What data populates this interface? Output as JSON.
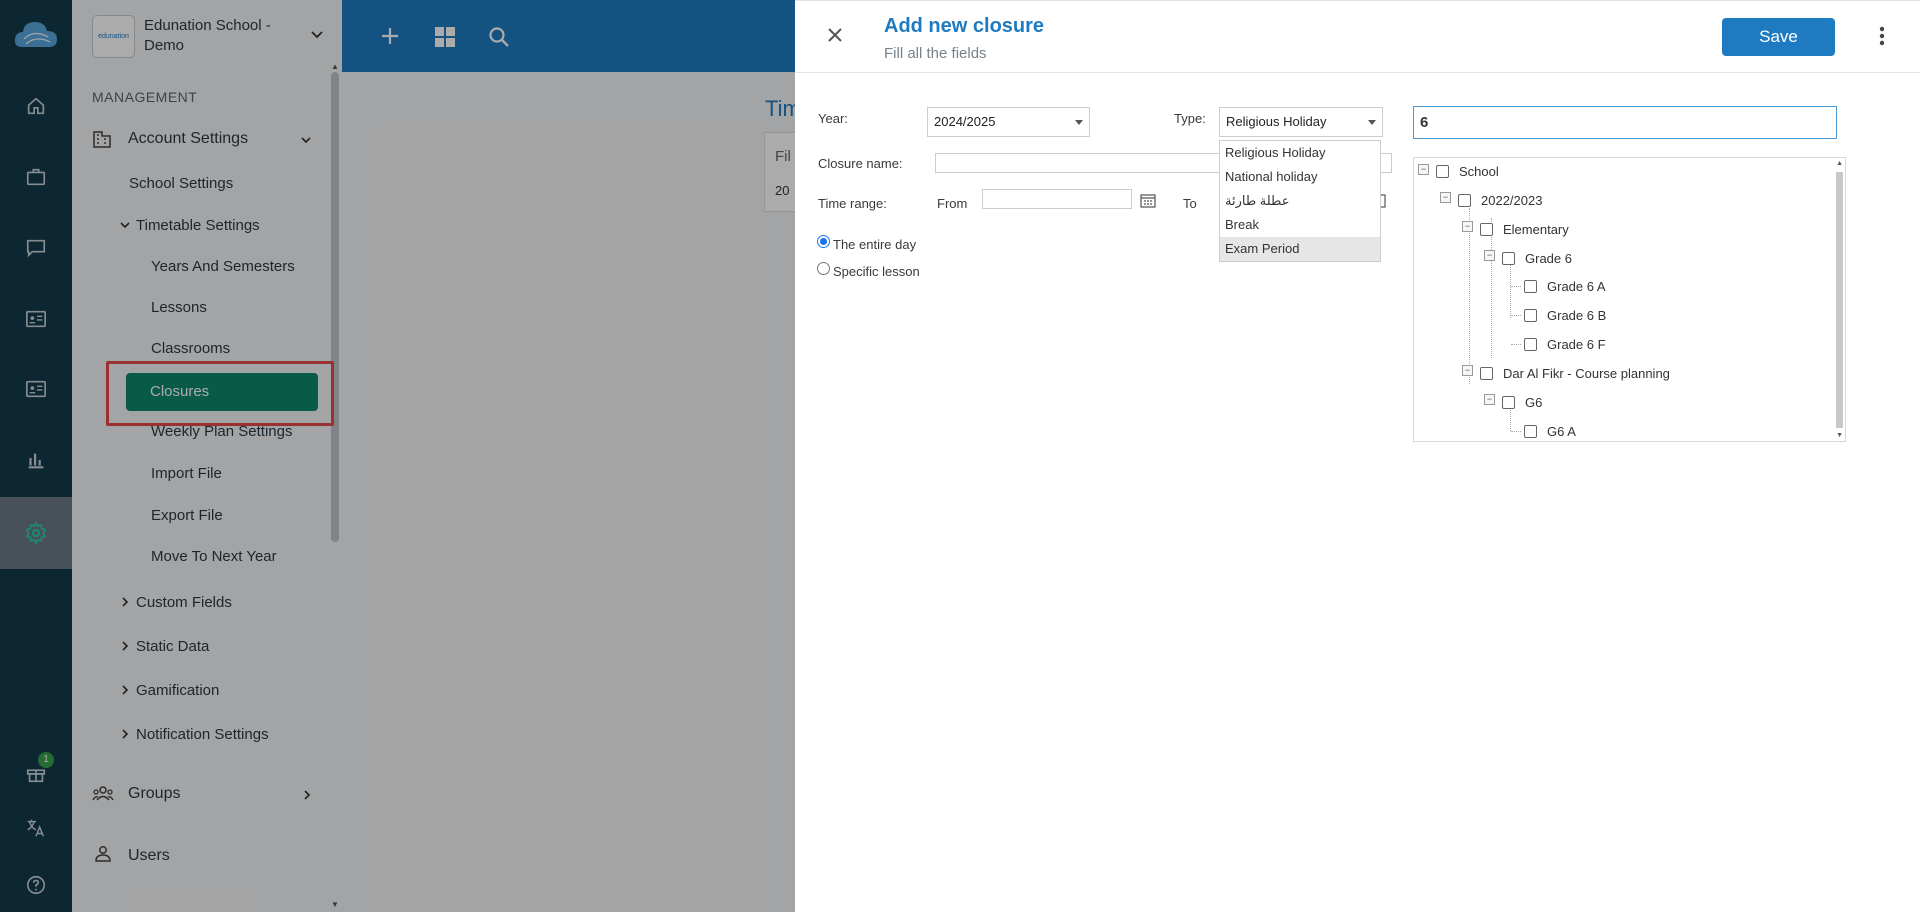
{
  "sidebar": {
    "school_name": "Edunation School - Demo",
    "school_logo_text": "edunation",
    "section_label": "MANAGEMENT",
    "items": {
      "account_settings": "Account Settings",
      "school_settings": "School Settings",
      "timetable_settings": "Timetable Settings",
      "years_semesters": "Years And Semesters",
      "lessons": "Lessons",
      "classrooms": "Classrooms",
      "closures": "Closures",
      "weekly_plan": "Weekly Plan Settings",
      "import_file": "Import File",
      "export_file": "Export File",
      "move_next_year": "Move To Next Year",
      "custom_fields": "Custom Fields",
      "static_data": "Static Data",
      "gamification": "Gamification",
      "notification_settings": "Notification Settings",
      "groups": "Groups",
      "users": "Users"
    }
  },
  "rail": {
    "gift_badge": "1"
  },
  "background": {
    "title_fragment": "Tim",
    "filter_fragment": "Fil",
    "year_fragment": "20"
  },
  "drawer": {
    "title": "Add new closure",
    "subtitle": "Fill all the fields",
    "save_label": "Save",
    "labels": {
      "year": "Year:",
      "type": "Type:",
      "closure_name": "Closure name:",
      "time_range": "Time range:",
      "from": "From",
      "to": "To"
    },
    "year_value": "2024/2025",
    "type_value": "Religious Holiday",
    "type_options": [
      "Religious Holiday",
      "National holiday",
      "عطلة طارئة",
      "Break",
      "Exam Period"
    ],
    "radio_entire_day": "The entire day",
    "radio_specific_lesson": "Specific lesson",
    "search_value": "6",
    "tree": {
      "school": "School",
      "year": "2022/2023",
      "elementary": "Elementary",
      "grade6": "Grade 6",
      "grade6a": "Grade 6 A",
      "grade6b": "Grade 6 B",
      "grade6f": "Grade 6 F",
      "darfikr": "Dar Al Fikr - Course planning",
      "g6": "G6",
      "g6a": "G6 A"
    }
  },
  "colors": {
    "brand_blue": "#1f7bc1",
    "active_green": "#0d8a6a",
    "highlight_red": "#e44a4a",
    "rail_dark": "#12394b"
  }
}
